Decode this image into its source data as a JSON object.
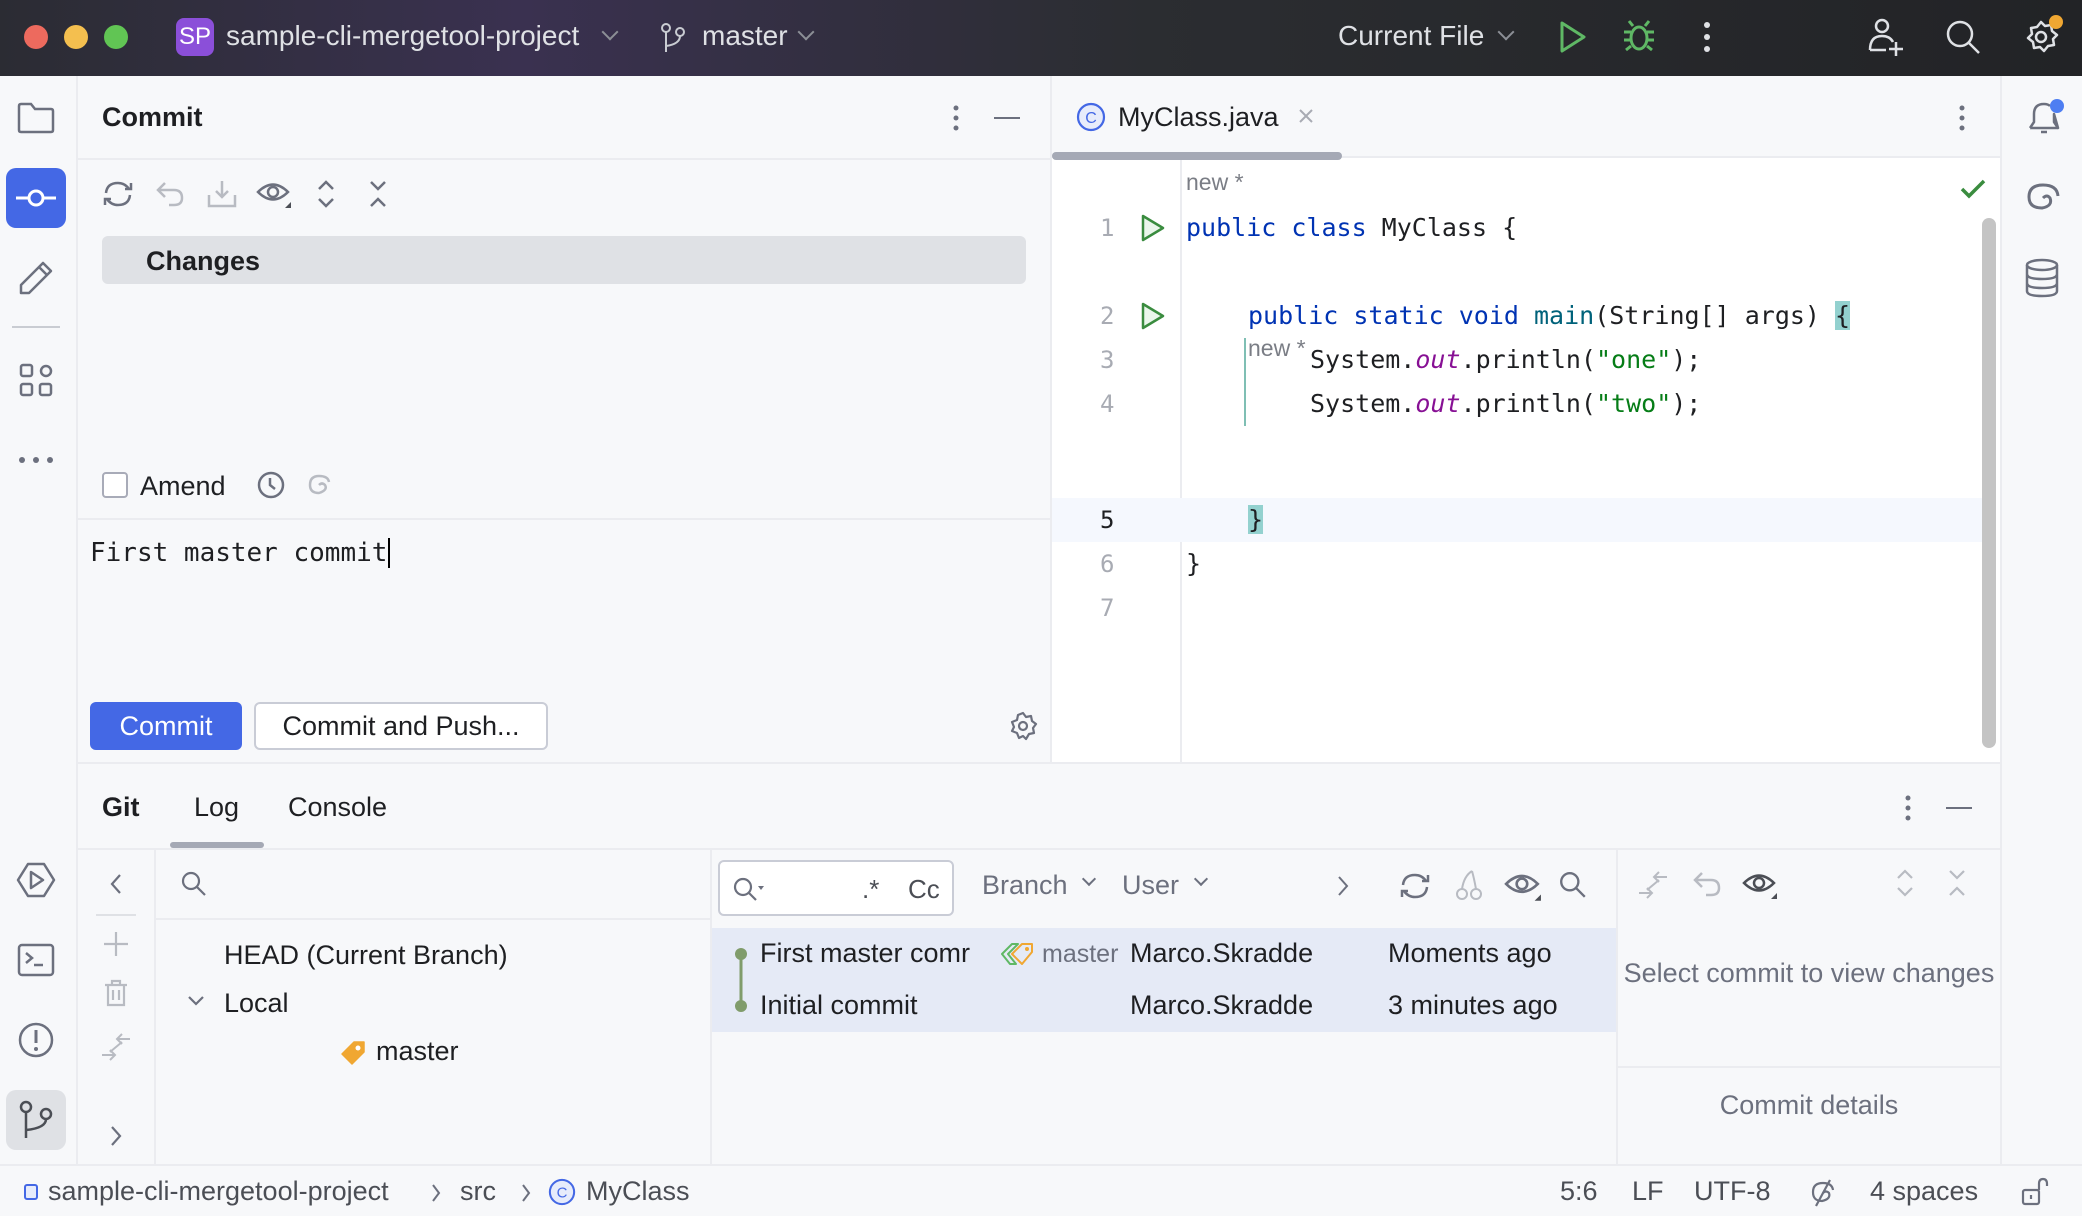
{
  "titlebar": {
    "project_badge": "SP",
    "project_name": "sample-cli-mergetool-project",
    "branch": "master",
    "run_config": "Current File",
    "colors": {
      "badge": "#8b4fd9",
      "run": "#5fb865",
      "close": "#ed6a5e",
      "minimize": "#f4bf4f",
      "maximize": "#61c554",
      "settings_dot": "#f0a732"
    }
  },
  "left_toolbar": {
    "items": [
      {
        "name": "project",
        "icon": "folder-icon"
      },
      {
        "name": "commit",
        "icon": "commit-icon",
        "active": true
      },
      {
        "name": "pull-requests",
        "icon": "pencil-icon"
      },
      {
        "name": "structure",
        "icon": "structure-icon"
      },
      {
        "name": "more",
        "icon": "more-horizontal-icon"
      },
      {
        "name": "services",
        "icon": "services-icon"
      },
      {
        "name": "terminal",
        "icon": "terminal-icon"
      },
      {
        "name": "problems",
        "icon": "problems-icon"
      },
      {
        "name": "git",
        "icon": "git-branch-icon",
        "active": true
      }
    ]
  },
  "commit_panel": {
    "title": "Commit",
    "changes_label": "Changes",
    "amend_label": "Amend",
    "amend_checked": false,
    "message": "First master commit",
    "commit_button": "Commit",
    "commit_push_button": "Commit and Push...",
    "accent": "#4468e5"
  },
  "editor": {
    "tab_label": "MyClass.java",
    "inlay_hint": "new *",
    "lines": [
      {
        "n": "1",
        "runnable": true
      },
      {
        "n": "2",
        "runnable": true
      },
      {
        "n": "3"
      },
      {
        "n": "4"
      },
      {
        "n": "5",
        "current": true
      },
      {
        "n": "6"
      },
      {
        "n": "7"
      }
    ],
    "code": {
      "l1_kw": "public class ",
      "l1_name": "MyClass {",
      "l2_kw": "public static void ",
      "l2_fn": "main",
      "l2_rest": "(String[] args) ",
      "l2_brace": "{",
      "sys": "System.",
      "out": "out",
      "println": ".println(",
      "one": "\"one\"",
      "two": "\"two\"",
      "end": ");",
      "l5": "}",
      "l6": "}"
    }
  },
  "bottom_panel": {
    "title": "Git",
    "tabs": [
      {
        "label": "Log",
        "active": true
      },
      {
        "label": "Console",
        "active": false
      }
    ],
    "branches": {
      "head": "HEAD (Current Branch)",
      "local_label": "Local",
      "local_branches": [
        "master"
      ]
    },
    "log_filters": {
      "regex": ".*",
      "case": "Cc",
      "branch": "Branch",
      "user": "User"
    },
    "commits": [
      {
        "message": "First master comr",
        "ref": "master",
        "author": "Marco.Skradde",
        "date": "Moments ago"
      },
      {
        "message": "Initial commit",
        "ref": "",
        "author": "Marco.Skradde",
        "date": "3 minutes ago"
      }
    ],
    "details_empty": "Select commit to view changes",
    "commit_details": "Commit details"
  },
  "statusbar": {
    "breadcrumb": [
      "sample-cli-mergetool-project",
      "src",
      "MyClass"
    ],
    "position": "5:6",
    "line_sep": "LF",
    "encoding": "UTF-8",
    "indent": "4 spaces"
  }
}
